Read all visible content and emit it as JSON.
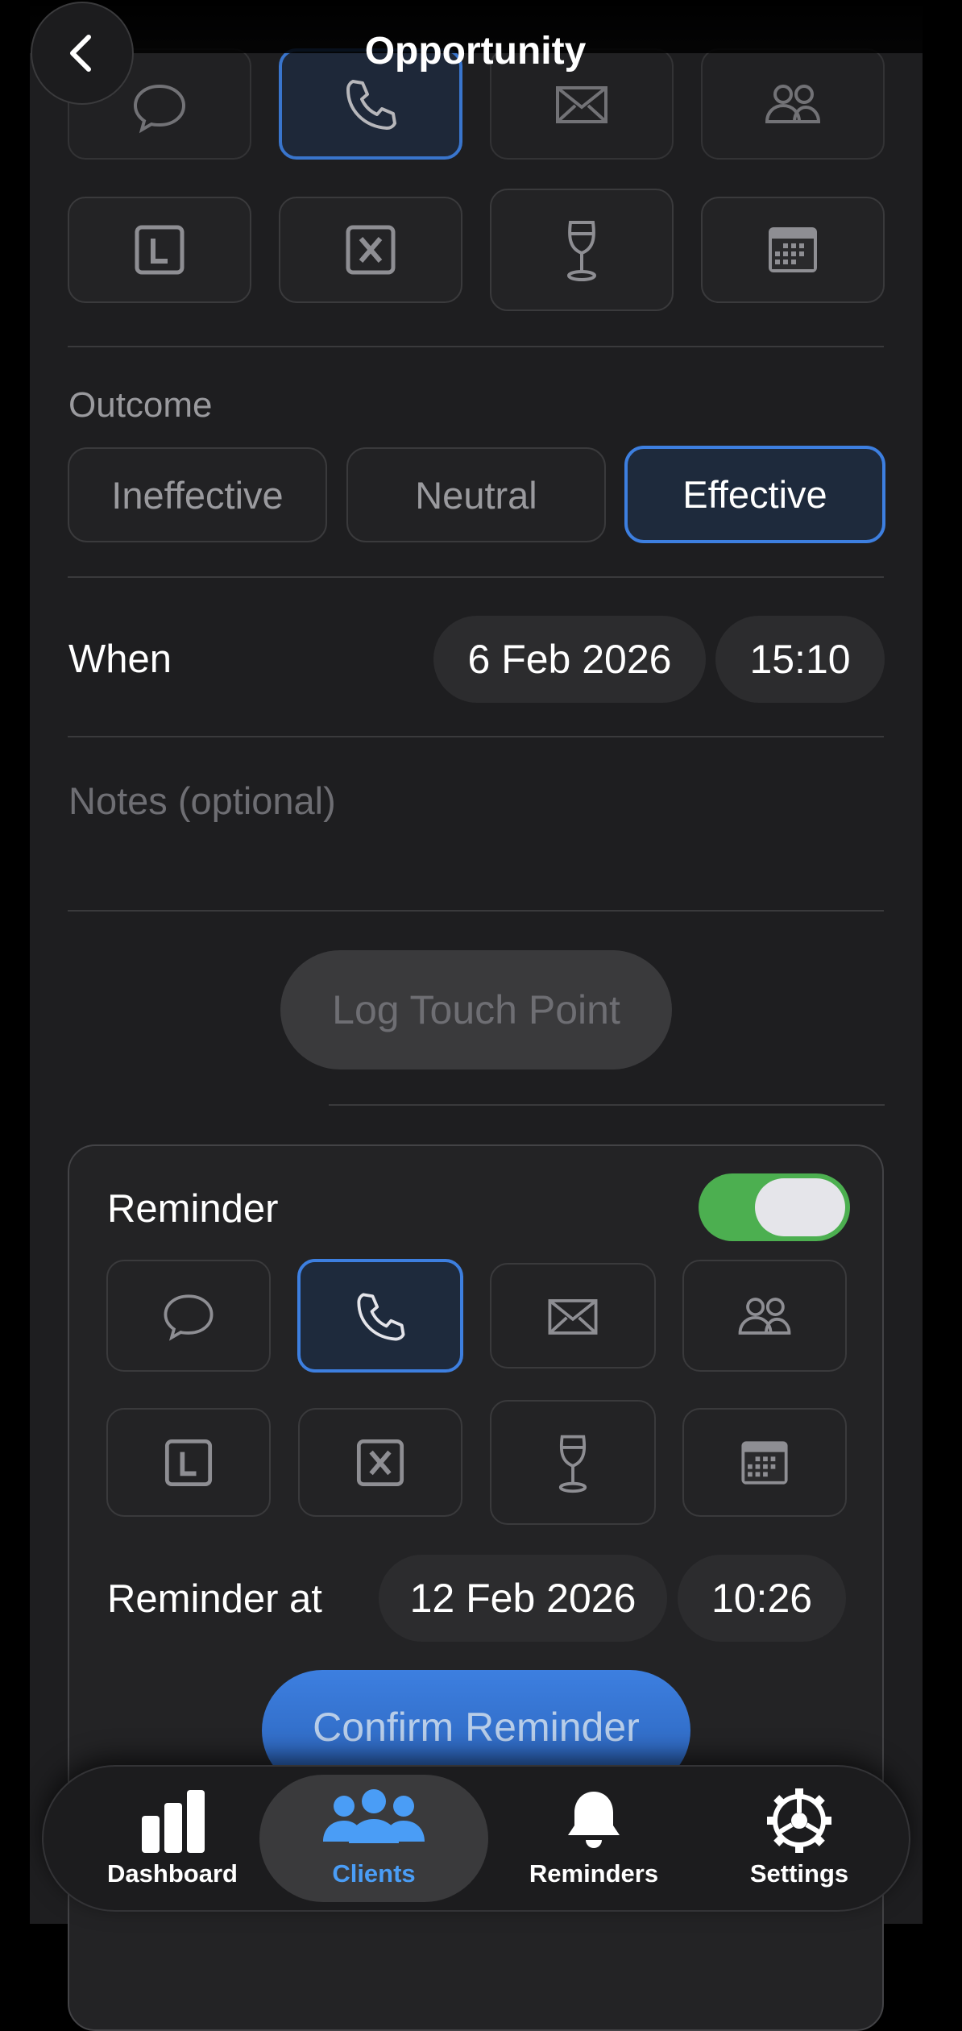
{
  "header": {
    "title": "Opportunity"
  },
  "colors": {
    "accent": "#3d7fe0",
    "toggle_on": "#4caf50",
    "tab_active": "#4a9df6",
    "confirm": "#3d7fe0"
  },
  "touch_types": [
    "chat-icon",
    "phone-icon",
    "email-icon",
    "people-icon",
    "linkedin-icon",
    "x-icon",
    "wine-glass-icon",
    "calendar-icon"
  ],
  "selected_touch_type": "phone-icon",
  "outcome": {
    "label": "Outcome",
    "options": [
      "Ineffective",
      "Neutral",
      "Effective"
    ],
    "selected": "Effective"
  },
  "when": {
    "label": "When",
    "date": "6 Feb 2026",
    "time": "15:10"
  },
  "notes": {
    "placeholder": "Notes (optional)"
  },
  "log_button": {
    "label": "Log Touch Point"
  },
  "reminder": {
    "label": "Reminder",
    "enabled": true,
    "selected_type": "phone-icon",
    "at_label": "Reminder at",
    "date": "12 Feb 2026",
    "time": "10:26",
    "confirm_label": "Confirm Reminder"
  },
  "tabbar": {
    "items": [
      {
        "label": "Dashboard",
        "icon": "bar-chart-icon"
      },
      {
        "label": "Clients",
        "icon": "people-icon"
      },
      {
        "label": "Reminders",
        "icon": "bell-icon"
      },
      {
        "label": "Settings",
        "icon": "gear-icon"
      }
    ],
    "selected": "Clients"
  }
}
